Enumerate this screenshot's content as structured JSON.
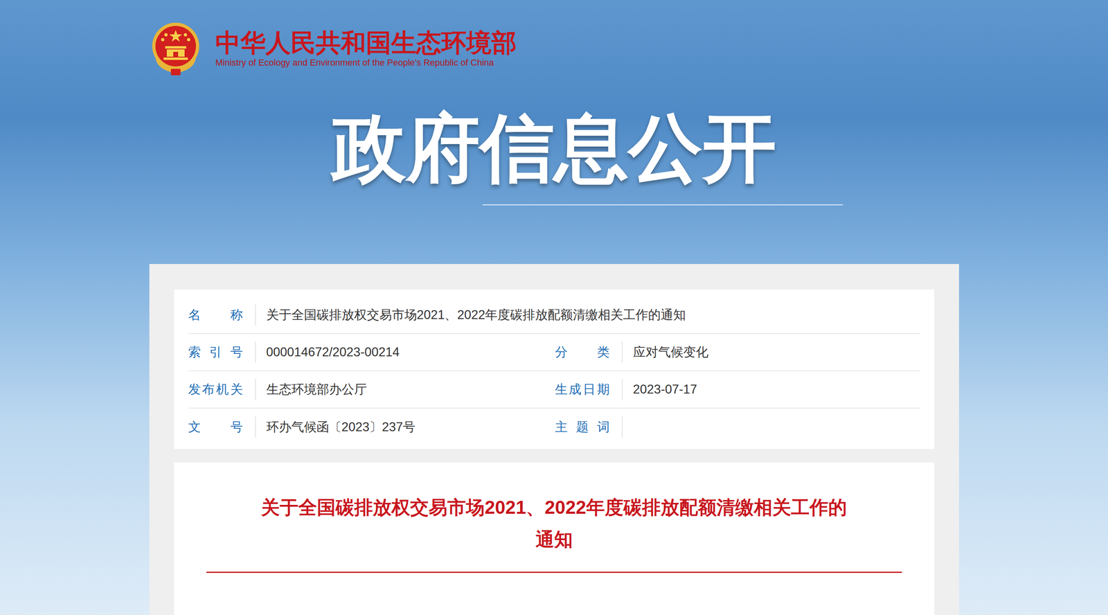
{
  "header": {
    "title": "中华人民共和国生态环境部",
    "subtitle": "Ministry of Ecology and Environment of the People's Republic of China"
  },
  "banner": "政府信息公开",
  "meta": {
    "rows": [
      [
        {
          "label": "名称",
          "value": "关于全国碳排放权交易市场2021、2022年度碳排放配额清缴相关工作的通知"
        }
      ],
      [
        {
          "label": "索引号",
          "value": "000014672/2023-00214"
        },
        {
          "label": "分类",
          "value": "应对气候变化"
        }
      ],
      [
        {
          "label": "发布机关",
          "value": "生态环境部办公厅"
        },
        {
          "label": "生成日期",
          "value": "2023-07-17"
        }
      ],
      [
        {
          "label": "文号",
          "value": "环办气候函〔2023〕237号"
        },
        {
          "label": "主题词",
          "value": ""
        }
      ]
    ]
  },
  "document": {
    "title": "关于全国碳排放权交易市场2021、2022年度碳排放配额清缴相关工作的通知"
  }
}
